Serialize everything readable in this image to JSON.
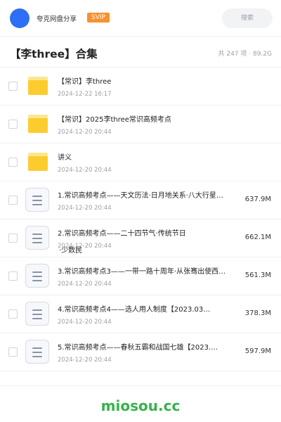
{
  "header": {
    "user_name": "夸克网盘分享",
    "badge": "SVIP",
    "search_placeholder": "搜索"
  },
  "collection": {
    "title": "【李three】合集",
    "summary": "共 247 项 · 89.2G"
  },
  "files": [
    {
      "type": "folder",
      "name": "【常识】李three",
      "date": "2024-12-22 16:17",
      "size": ""
    },
    {
      "type": "folder",
      "name": "【常识】2025李three常识高频考点",
      "date": "2024-12-20 20:44",
      "size": ""
    },
    {
      "type": "folder",
      "name": "讲义",
      "date": "2024-12-20 20:44",
      "size": ""
    },
    {
      "type": "doc",
      "name": "1.常识高频考点——天文历法·日月地关系·八大行星…",
      "date": "2024-12-20 20:44",
      "size": "637.9M"
    },
    {
      "type": "doc",
      "name": "2.常识高频考点——二十四节气·传统节日",
      "date": "2024-12-20 20:44",
      "size": "662.1M",
      "overflow": "·少数民"
    },
    {
      "type": "doc",
      "name": "3.常识高频考点3——一带一路十周年·从张骞出使西…",
      "date": "2024-12-20 20:44",
      "size": "561.3M"
    },
    {
      "type": "doc",
      "name": "4.常识高频考点4——选人用人制度【2023.03…",
      "date": "2024-12-20 20:44",
      "size": "378.3M"
    },
    {
      "type": "doc",
      "name": "5.常识高频考点——春秋五霸和战国七雄【2023.…",
      "date": "2024-12-20 20:44",
      "size": "597.9M"
    }
  ],
  "footer": {
    "watermark": "miosou.cc"
  }
}
